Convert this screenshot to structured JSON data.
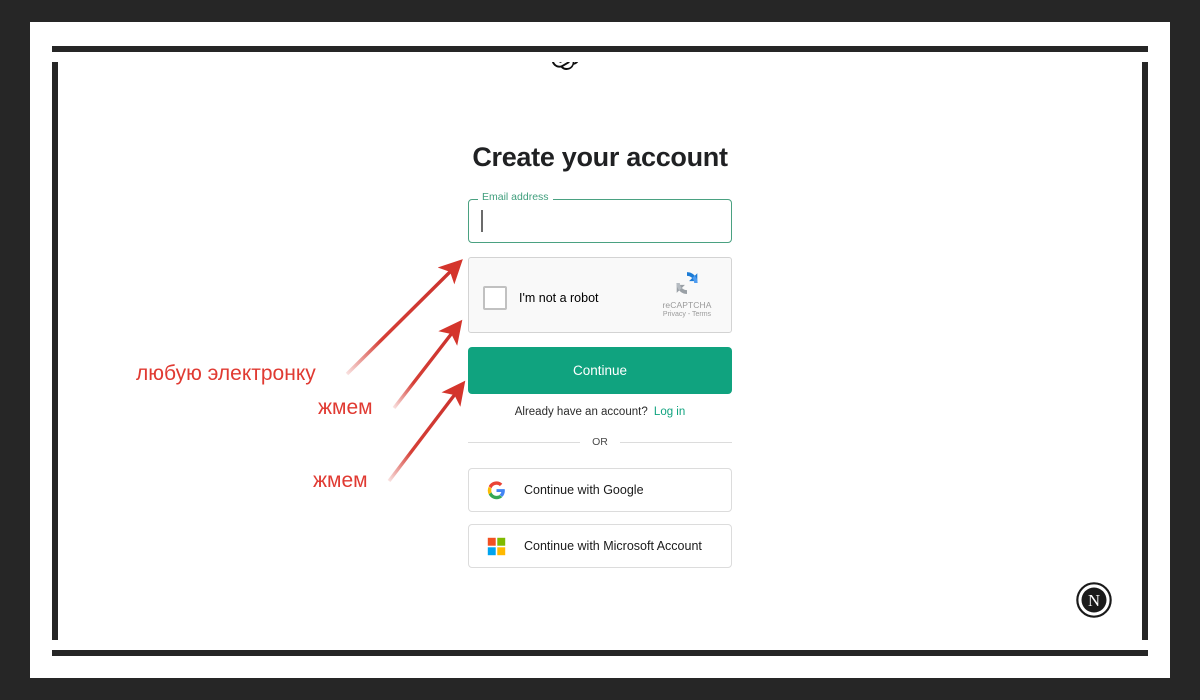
{
  "brand": {
    "logo_icon": "openai-logo",
    "watermark_icon": "n-circle-watermark"
  },
  "colors": {
    "accent_green": "#10a37f",
    "field_border_green": "#4aa181",
    "annotation_red": "#e03a32",
    "frame_dark": "#262626",
    "title_dark": "#202123"
  },
  "auth": {
    "title": "Create your account",
    "email": {
      "label": "Email address",
      "value": "",
      "placeholder": ""
    },
    "recaptcha": {
      "checkbox_icon": "recaptcha-checkbox",
      "label": "I'm not a robot",
      "logo_icon": "recaptcha-logo",
      "brand_name": "reCAPTCHA",
      "privacy": "Privacy",
      "separator": "-",
      "terms": "Terms"
    },
    "continue_label": "Continue",
    "have_account_text": "Already have an account?",
    "login_label": "Log in",
    "divider_label": "OR",
    "social": [
      {
        "icon": "google-logo",
        "label": "Continue with Google"
      },
      {
        "icon": "microsoft-logo",
        "label": "Continue with Microsoft Account"
      }
    ]
  },
  "annotations": [
    {
      "text": "любую электронку",
      "arrow": "arrow-to-email-field"
    },
    {
      "text": "жмем",
      "arrow": "arrow-to-recaptcha"
    },
    {
      "text": "жмем",
      "arrow": "arrow-to-continue-button"
    }
  ]
}
